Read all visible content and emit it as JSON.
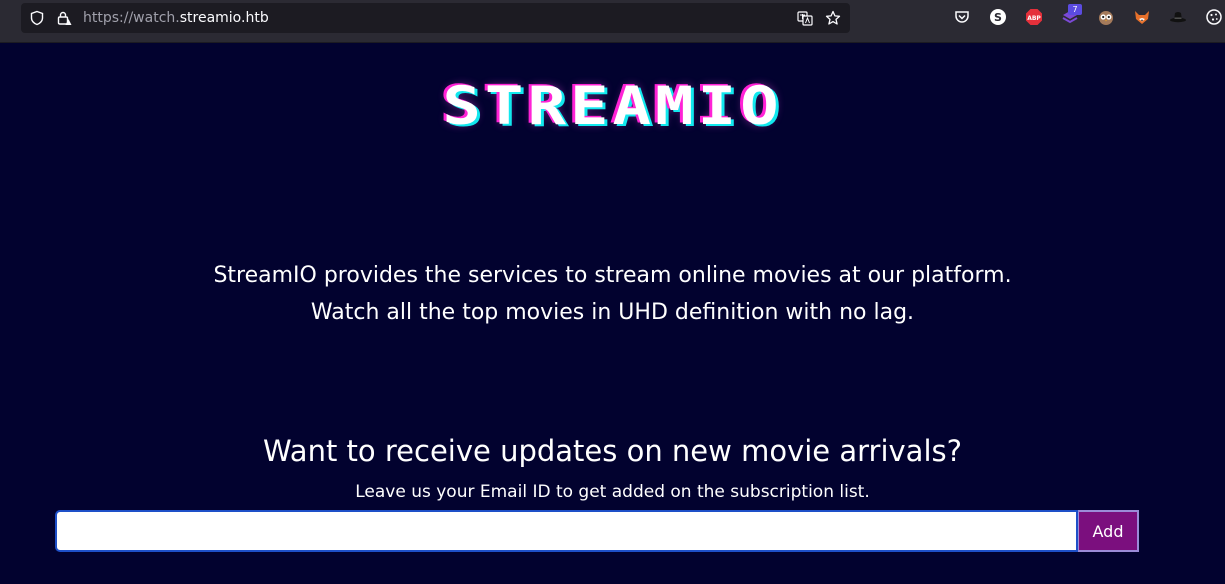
{
  "browser": {
    "url_prefix": "https://watch.",
    "url_host": "streamio.htb",
    "icons": {
      "shield": "shield-icon",
      "lock": "lock-warning-icon",
      "translate": "translate-icon",
      "bookmark": "star-icon"
    },
    "extensions": [
      {
        "name": "pocket-icon"
      },
      {
        "name": "s-extension-icon",
        "label": "S"
      },
      {
        "name": "adblock-plus-icon",
        "label": "ABP"
      },
      {
        "name": "extension-badge-icon",
        "badge": "7"
      },
      {
        "name": "owl-extension-icon"
      },
      {
        "name": "fox-extension-icon"
      },
      {
        "name": "hat-extension-icon"
      },
      {
        "name": "cookie-icon"
      }
    ]
  },
  "page": {
    "logo_text": "STREAMIO",
    "intro_line1": "StreamIO provides the services to stream online movies at our platform.",
    "intro_line2": "Watch all the top movies in UHD definition with no lag.",
    "subscribe_heading": "Want to receive updates on new movie arrivals?",
    "subscribe_subheading": "Leave us your Email ID to get added on the subscription list.",
    "email_value": "",
    "email_placeholder": "",
    "add_button": "Add"
  },
  "colors": {
    "page_background": "#02022f",
    "button_background": "#7b0f7e",
    "input_border": "#1e50c8",
    "logo_pink": "#ff22d6",
    "logo_cyan": "#11e8ee"
  }
}
